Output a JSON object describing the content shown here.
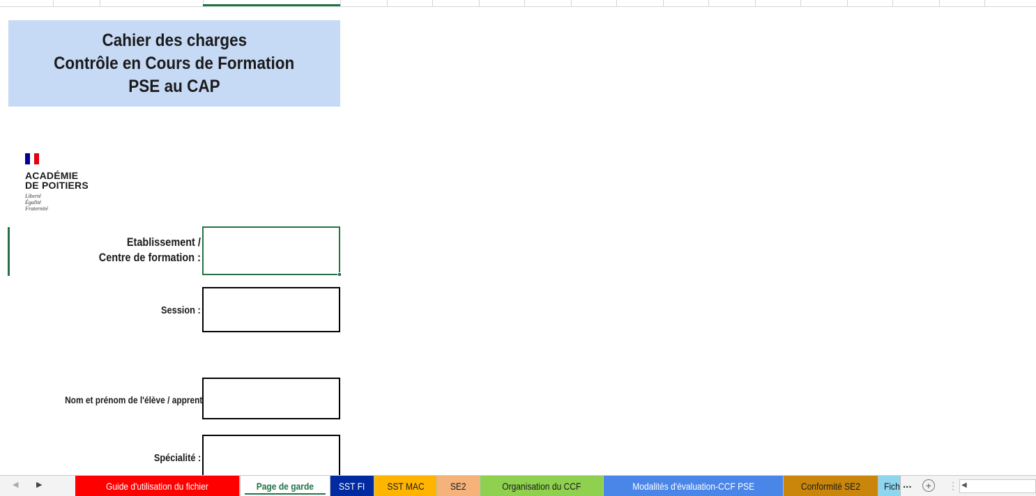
{
  "document": {
    "title_lines": [
      "Cahier des charges",
      "Contrôle en Cours de Formation",
      "PSE au CAP"
    ]
  },
  "logo": {
    "name_lines": [
      "ACADÉMIE",
      "DE POITIERS"
    ],
    "motto_lines": [
      "Liberté",
      "Égalité",
      "Fraternité"
    ],
    "flag_colors": [
      "#000091",
      "#ffffff",
      "#e1000f"
    ]
  },
  "form": {
    "fields": [
      {
        "label_lines": [
          "Etablissement /",
          "Centre de formation :"
        ],
        "value": ""
      },
      {
        "label": "Session :",
        "value": ""
      },
      {
        "label": "Nom et prénom de l'élève / apprenti:",
        "value": ""
      },
      {
        "label": "Spécialité :",
        "value": ""
      }
    ]
  },
  "sheet_tabs": [
    {
      "label": "Guide d'utilisation du fichier",
      "color": "#ff0000",
      "text_color": "#ffffff"
    },
    {
      "label": "Page de garde",
      "color": "#ffffff",
      "text_color": "#217346",
      "active": true
    },
    {
      "label": "SST FI",
      "color": "#002aa0",
      "text_color": "#ffffff"
    },
    {
      "label": "SST MAC",
      "color": "#ffb400",
      "text_color": "#1a1a1a"
    },
    {
      "label": "SE2",
      "color": "#f5b27a",
      "text_color": "#1a1a1a"
    },
    {
      "label": "Organisation du CCF",
      "color": "#8fd14f",
      "text_color": "#1a1a1a"
    },
    {
      "label": "Modalités d'évaluation-CCF PSE",
      "color": "#4a86e8",
      "text_color": "#ffffff"
    },
    {
      "label": "Conformité SE2",
      "color": "#c9860b",
      "text_color": "#1a1a1a"
    },
    {
      "label": "Fiche réc",
      "color": "#8ed6f0",
      "text_color": "#1a1a1a"
    }
  ],
  "tabbar": {
    "more_label": "...",
    "add_label": "+"
  },
  "colors": {
    "excel_green": "#217346",
    "title_fill": "#c6d9f5"
  }
}
